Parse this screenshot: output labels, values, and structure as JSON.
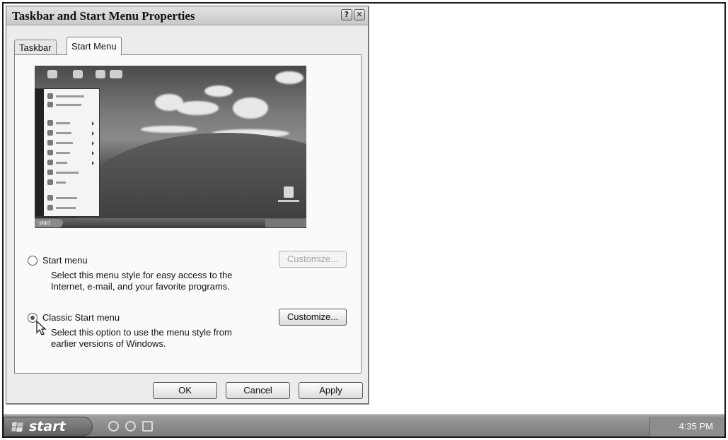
{
  "window": {
    "title": "Taskbar and Start Menu Properties",
    "help_glyph": "?",
    "close_glyph": "✕"
  },
  "tabs": [
    {
      "label": "Taskbar",
      "selected": false
    },
    {
      "label": "Start Menu",
      "selected": true
    }
  ],
  "preview": {
    "start_label": "start"
  },
  "options": {
    "start_menu": {
      "label": "Start menu",
      "description": "Select this menu style for easy access to the Internet, e-mail, and your favorite programs.",
      "selected": false,
      "customize_label": "Customize...",
      "customize_enabled": false
    },
    "classic_start_menu": {
      "label": "Classic Start menu",
      "description": "Select this option to use the menu style from earlier versions of Windows.",
      "selected": true,
      "customize_label": "Customize...",
      "customize_enabled": true
    }
  },
  "buttons": {
    "ok": "OK",
    "cancel": "Cancel",
    "apply": "Apply"
  },
  "taskbar": {
    "start_label": "start",
    "quick_launch_icons": [
      "internet-explorer-icon",
      "media-player-icon",
      "outlook-express-icon"
    ],
    "clock": "4:35 PM"
  }
}
